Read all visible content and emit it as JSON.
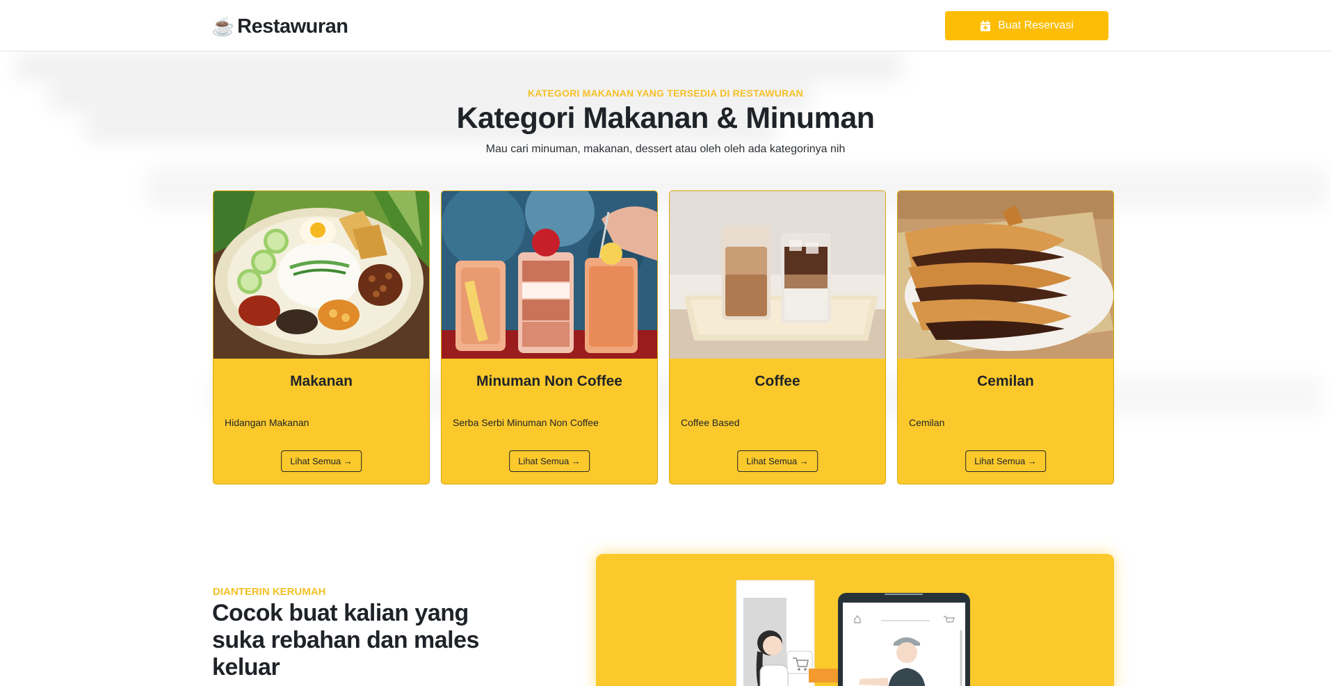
{
  "navbar": {
    "brand_icon": "coffee-cup-icon",
    "brand_name": "Restawuran",
    "reserve_label": "Buat Reservasi",
    "reserve_icon": "calendar-plus-icon"
  },
  "category_section": {
    "kicker": "KATEGORI MAKANAN YANG TERSEDIA DI RESTAWURAN",
    "title": "Kategori Makanan & Minuman",
    "subtitle": "Mau cari minuman, makanan, dessert atau oleh oleh ada kategorinya nih",
    "cards": [
      {
        "title": "Makanan",
        "description": "Hidangan Makanan",
        "link_label": "Lihat Semua →",
        "image": "nasi-lemak-plate-illustration"
      },
      {
        "title": "Minuman Non Coffee",
        "description": "Serba Serbi Minuman Non Coffee",
        "link_label": "Lihat Semua →",
        "image": "smoothie-glasses-photo"
      },
      {
        "title": "Coffee",
        "description": "Coffee Based",
        "link_label": "Lihat Semua →",
        "image": "iced-coffee-glasses-photo"
      },
      {
        "title": "Cemilan",
        "description": "Cemilan",
        "link_label": "Lihat Semua →",
        "image": "folded-pancake-snack-photo"
      }
    ]
  },
  "delivery_section": {
    "kicker": "DIANTERIN KERUMAH",
    "title": "Cocok buat kalian yang suka rebahan dan males keluar",
    "image": "online-delivery-illustration"
  },
  "colors": {
    "accent": "#fcbd04",
    "card_bg": "#fbc92c",
    "kicker": "#f5c026",
    "text": "#1f2328"
  }
}
